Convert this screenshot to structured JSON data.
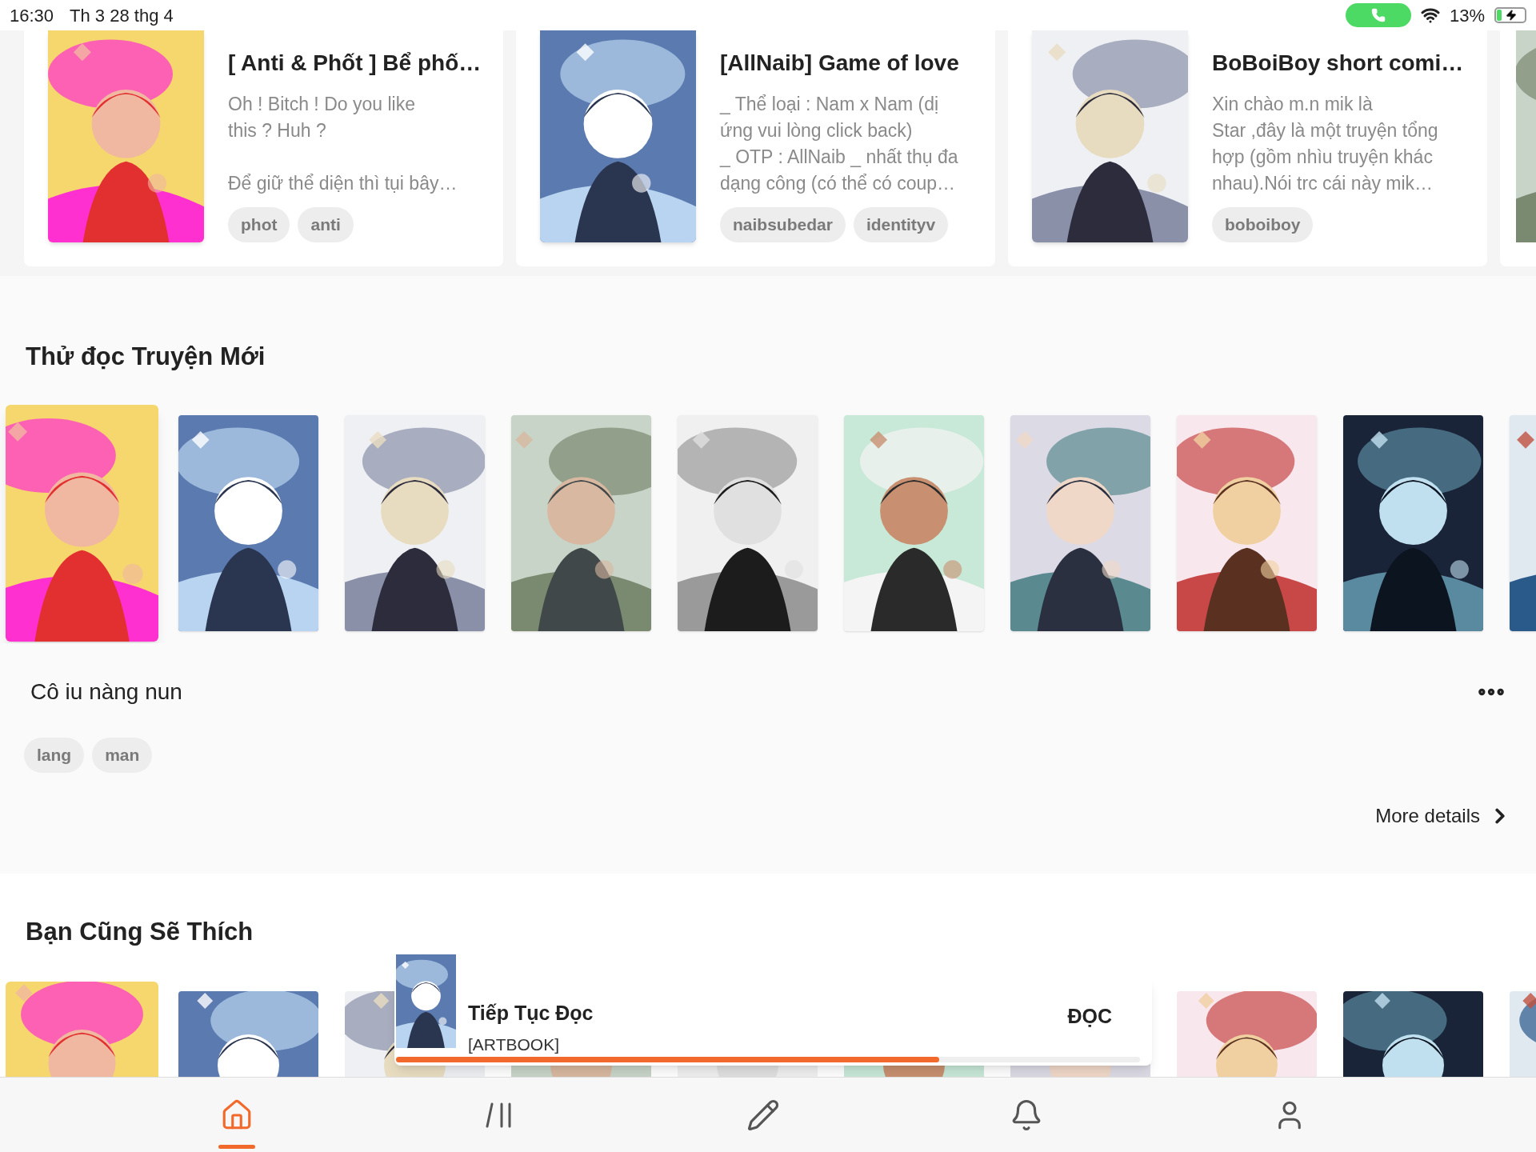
{
  "status_bar": {
    "time": "16:30",
    "date": "Th 3 28 thg 4",
    "battery": "13%"
  },
  "featured": [
    {
      "title": "[ Anti & Phốt ] Bể phố…",
      "paragraphs": [
        [
          "Oh ! Bitch ! Do you like",
          "this ? Huh ?"
        ],
        [
          "Để giữ thể diện thì tụi bây…"
        ]
      ],
      "tags": [
        "phot",
        "anti"
      ]
    },
    {
      "title": "[AllNaib] Game of love",
      "paragraphs": [
        [
          "_ Thể loại : Nam x Nam (dị",
          "ứng vui lòng click back)",
          "_ OTP : AllNaib _ nhất thụ đa",
          "dạng công (có thể có coup…"
        ]
      ],
      "tags": [
        "naibsubedar",
        "identityv"
      ]
    },
    {
      "title": "BoBoiBoy short comi…",
      "paragraphs": [
        [
          "Xin chào m.n mik là",
          "Star ,đây là một truyện tổng",
          "hợp (gồm nhìu truyện khác",
          "nhau).Nói trc cái này mik…"
        ]
      ],
      "tags": [
        "boboiboy"
      ]
    }
  ],
  "new_stories": {
    "heading": "Thử đọc Truyện Mới",
    "covers": [
      {
        "selected": true
      },
      {
        "selected": false
      },
      {
        "selected": false
      },
      {
        "selected": false
      },
      {
        "selected": false
      },
      {
        "selected": false
      },
      {
        "selected": false
      },
      {
        "selected": false
      },
      {
        "selected": false
      },
      {
        "selected": false
      }
    ],
    "story": {
      "title": "Cô iu nàng nun",
      "tags": [
        "lang",
        "man"
      ]
    },
    "more_label": "More details"
  },
  "recommended": {
    "heading": "Bạn Cũng Sẽ Thích"
  },
  "continue_reading": {
    "title": "Tiếp Tục Đọc",
    "chapter": "[ARTBOOK]",
    "action": "ĐỌC",
    "level": 0.73
  },
  "nav": [
    {
      "kind": "home",
      "selected": true
    },
    {
      "kind": "library",
      "selected": false
    },
    {
      "kind": "write",
      "selected": false
    },
    {
      "kind": "notifications",
      "selected": false
    },
    {
      "kind": "profile",
      "selected": false
    }
  ]
}
